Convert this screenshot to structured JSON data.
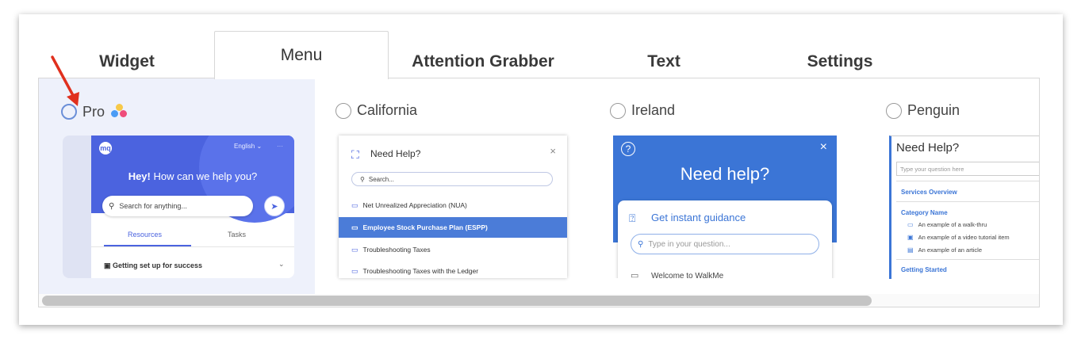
{
  "tabs": [
    {
      "label": "Widget",
      "active": false
    },
    {
      "label": "Menu",
      "active": true
    },
    {
      "label": "Attention Grabber",
      "active": false
    },
    {
      "label": "Text",
      "active": false
    },
    {
      "label": "Settings",
      "active": false
    }
  ],
  "options": {
    "pro": {
      "label": "Pro",
      "selected": true,
      "dot_colors": [
        "#f7c948",
        "#4b9cf5",
        "#ef4d7a"
      ],
      "preview": {
        "logo": "mq",
        "language": "English ⌄",
        "menu": "···",
        "greeting_bold": "Hey!",
        "greeting_rest": " How can we help you?",
        "search_placeholder": "Search for anything...",
        "tab_resources": "Resources",
        "tab_tasks": "Tasks",
        "item": "Getting set up for success"
      }
    },
    "california": {
      "label": "California",
      "selected": false,
      "preview": {
        "title": "Need Help?",
        "close": "×",
        "search": "Search...",
        "items": [
          "Net Unrealized Appreciation (NUA)",
          "Employee Stock Purchase Plan (ESPP)",
          "Troubleshooting Taxes",
          "Troubleshooting Taxes with the Ledger"
        ]
      }
    },
    "ireland": {
      "label": "Ireland",
      "selected": false,
      "preview": {
        "title": "Need help?",
        "close": "×",
        "guidance": "Get instant guidance",
        "input_placeholder": "Type in your question...",
        "welcome": "Welcome to WalkMe"
      }
    },
    "penguin": {
      "label": "Penguin",
      "selected": false,
      "preview": {
        "title": "Need Help?",
        "input_placeholder": "Type your question here",
        "section1": "Services Overview",
        "section2": "Category Name",
        "items": [
          "An example of a walk-thru",
          "An example of a video tutorial item",
          "An example of an article"
        ],
        "section3": "Getting Started"
      }
    }
  },
  "colors": {
    "accent": "#4b63df",
    "annotation_arrow": "#e0301e"
  }
}
